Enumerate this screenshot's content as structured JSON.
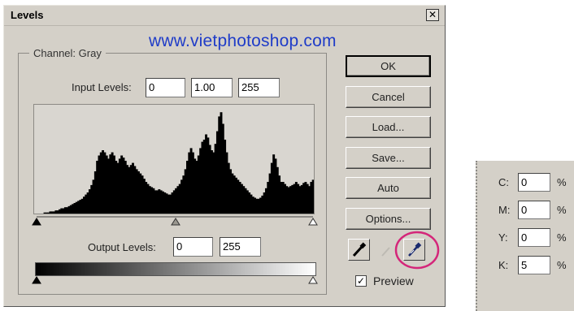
{
  "dialog": {
    "title": "Levels",
    "close_glyph": "✕",
    "watermark": "www.vietphotoshop.com",
    "channel_label": "Channel:",
    "channel_value": "Gray",
    "input_levels": {
      "label": "Input Levels:",
      "black": "0",
      "gamma": "1.00",
      "white": "255"
    },
    "output_levels": {
      "label": "Output Levels:",
      "black": "0",
      "white": "255"
    },
    "buttons": {
      "ok": "OK",
      "cancel": "Cancel",
      "load": "Load...",
      "save": "Save...",
      "auto": "Auto",
      "options": "Options..."
    },
    "preview": {
      "label": "Preview",
      "checked": true,
      "check_glyph": "✓"
    },
    "highlight_color": "#d4267a",
    "histogram": {
      "color": "#000000",
      "values": [
        0,
        0,
        0,
        0,
        0,
        1,
        1,
        1,
        2,
        2,
        2,
        3,
        3,
        4,
        5,
        5,
        6,
        6,
        7,
        8,
        9,
        10,
        11,
        12,
        13,
        14,
        16,
        18,
        20,
        23,
        27,
        32,
        40,
        50,
        55,
        58,
        60,
        58,
        55,
        52,
        56,
        58,
        55,
        50,
        48,
        52,
        55,
        53,
        50,
        46,
        44,
        46,
        48,
        45,
        42,
        40,
        38,
        36,
        33,
        30,
        28,
        26,
        25,
        24,
        22,
        22,
        23,
        22,
        21,
        20,
        19,
        18,
        18,
        20,
        22,
        24,
        26,
        28,
        32,
        36,
        42,
        50,
        58,
        62,
        58,
        52,
        50,
        55,
        62,
        68,
        70,
        75,
        72,
        65,
        60,
        58,
        66,
        78,
        92,
        96,
        85,
        70,
        58,
        48,
        42,
        38,
        36,
        34,
        32,
        30,
        28,
        26,
        24,
        22,
        20,
        18,
        16,
        15,
        14,
        14,
        15,
        17,
        20,
        24,
        30,
        38,
        48,
        56,
        52,
        44,
        36,
        30,
        30,
        28,
        26,
        25,
        26,
        27,
        28,
        30,
        28,
        26,
        27,
        29,
        30,
        28,
        26,
        30,
        32
      ]
    }
  },
  "info_panel": {
    "rows": [
      {
        "label": "C:",
        "value": "0",
        "unit": "%"
      },
      {
        "label": "M:",
        "value": "0",
        "unit": "%"
      },
      {
        "label": "Y:",
        "value": "0",
        "unit": "%"
      },
      {
        "label": "K:",
        "value": "5",
        "unit": "%"
      }
    ]
  }
}
